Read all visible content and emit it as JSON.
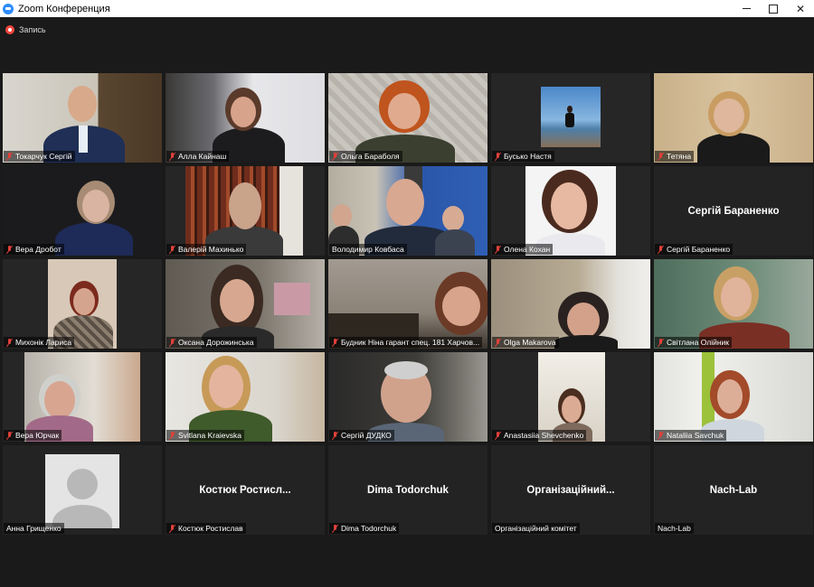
{
  "window": {
    "title": "Zoom Конференция"
  },
  "recording": {
    "label": "Запись"
  },
  "colors": {
    "active_speaker_border": "#c4f04a",
    "muted_mic": "#e0403a",
    "record": "#f2463c"
  },
  "participants": [
    {
      "name": "Токарчук Сергій",
      "muted": true
    },
    {
      "name": "Алла Кайнаш",
      "muted": true
    },
    {
      "name": "Ольга Бараболя",
      "muted": true
    },
    {
      "name": "Бусько Настя",
      "muted": true
    },
    {
      "name": "Тетяна",
      "muted": true
    },
    {
      "name": "Вера Дробот",
      "muted": true
    },
    {
      "name": "Валерій Махинько",
      "muted": true
    },
    {
      "name": "Володимир Ковбаса",
      "muted": false,
      "active": true
    },
    {
      "name": "Олена Кохан",
      "muted": true
    },
    {
      "name": "Сергій Бараненко",
      "muted": true,
      "center_label": "Сергій Бараненко"
    },
    {
      "name": "Михонік Лариса",
      "muted": true
    },
    {
      "name": "Оксана Дорожинська",
      "muted": true
    },
    {
      "name": "Будник Ніна гарант спец. 181 Харчов...",
      "muted": true
    },
    {
      "name": "Olga Makarova",
      "muted": true
    },
    {
      "name": "Світлана Олійник",
      "muted": true
    },
    {
      "name": "Вера Юрчак",
      "muted": true
    },
    {
      "name": "Svitlana Kraievska",
      "muted": true
    },
    {
      "name": "Сергій ДУДКО",
      "muted": true
    },
    {
      "name": "Anastasiia Shevchenko",
      "muted": true
    },
    {
      "name": "Nataliia Savchuk",
      "muted": true
    },
    {
      "name": "Анна Грищенко",
      "muted": false
    },
    {
      "name": "Костюк Ростислав",
      "muted": true,
      "center_label": "Костюк Ростисл..."
    },
    {
      "name": "Dima Todorchuk",
      "muted": true,
      "center_label": "Dima Todorchuk"
    },
    {
      "name": "Організаційний комітет",
      "muted": false,
      "center_label": "Організаційний..."
    },
    {
      "name": "Nach-Lab",
      "muted": false,
      "center_label": "Nach-Lab"
    }
  ]
}
